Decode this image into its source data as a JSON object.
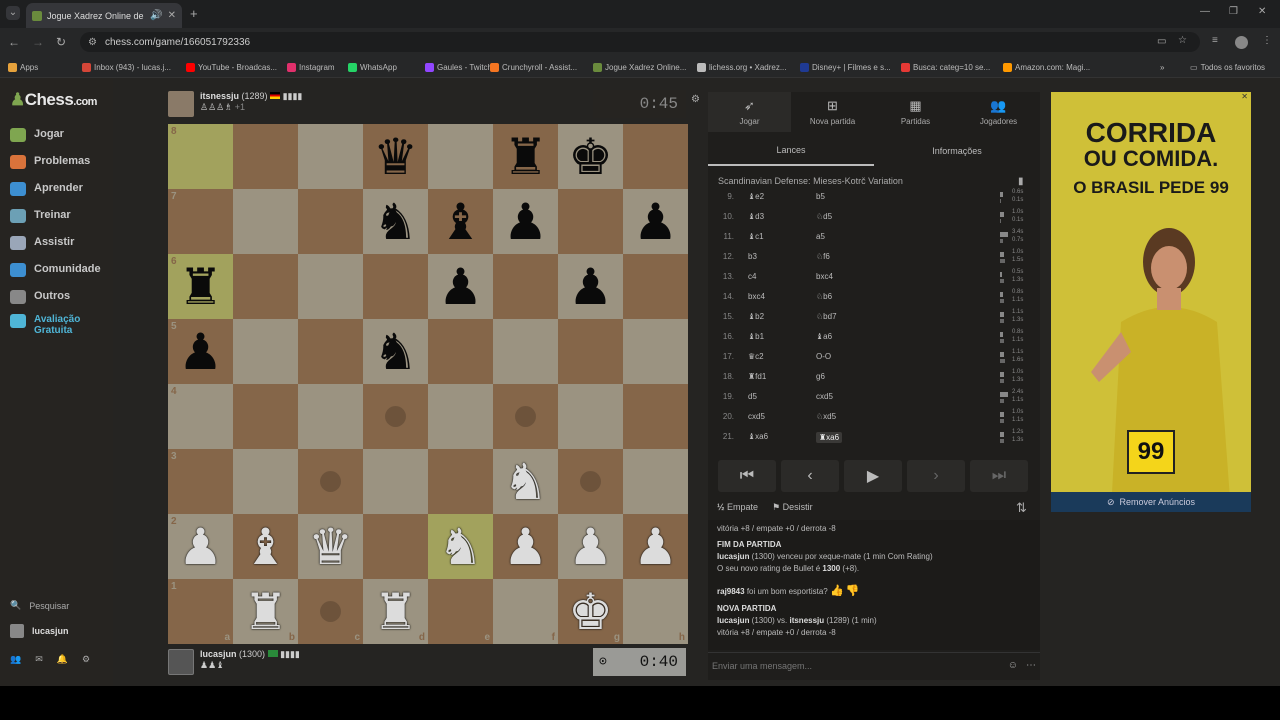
{
  "browser": {
    "tab_title": "Jogue Xadrez Online de GR",
    "url": "chess.com/game/166051792336",
    "bookmarks": [
      {
        "label": "Apps",
        "color": "#e6a23c"
      },
      {
        "label": "Inbox (943) - lucas.j...",
        "color": "#d44638"
      },
      {
        "label": "YouTube - Broadcas...",
        "color": "#ff0000"
      },
      {
        "label": "Instagram",
        "color": "#e1306c"
      },
      {
        "label": "WhatsApp",
        "color": "#25d366"
      },
      {
        "label": "Gaules - Twitch",
        "color": "#9146ff"
      },
      {
        "label": "Crunchyroll - Assist...",
        "color": "#f47521"
      },
      {
        "label": "Jogue Xadrez Online...",
        "color": "#6a8b3d"
      },
      {
        "label": "lichess.org • Xadrez...",
        "color": "#bbbbbb"
      },
      {
        "label": "Disney+ | Filmes e s...",
        "color": "#1f3a93"
      },
      {
        "label": "Busca: categ=10 se...",
        "color": "#e53935"
      },
      {
        "label": "Amazon.com: Magi...",
        "color": "#ff9900"
      }
    ],
    "all_bookmarks": "Todos os favoritos"
  },
  "sidebar": {
    "logo_main": "Chess",
    "logo_suffix": ".com",
    "items": [
      {
        "label": "Jogar",
        "color": "#7fa650"
      },
      {
        "label": "Problemas",
        "color": "#d9733b"
      },
      {
        "label": "Aprender",
        "color": "#3d8fd1"
      },
      {
        "label": "Treinar",
        "color": "#6ca0b5"
      },
      {
        "label": "Assistir",
        "color": "#9aa6b8"
      },
      {
        "label": "Comunidade",
        "color": "#3d8fd1"
      },
      {
        "label": "Outros",
        "color": "#888888"
      },
      {
        "label": "Avaliação Gratuita",
        "color": "#4fb5d6"
      }
    ],
    "search": "Pesquisar",
    "user": "lucasjun"
  },
  "game": {
    "top_player": {
      "name": "itsnessju",
      "rating": "(1289)",
      "captured": "♙♙♙♗",
      "diff": "+1",
      "clock": "0:45"
    },
    "bottom_player": {
      "name": "lucasjun",
      "rating": "(1300)",
      "captured": "♟♟♝",
      "clock": "0:40"
    },
    "ranks": [
      "8",
      "7",
      "6",
      "5",
      "4",
      "3",
      "2",
      "1"
    ],
    "files": [
      "a",
      "b",
      "c",
      "d",
      "e",
      "f",
      "g",
      "h"
    ],
    "board": [
      [
        "",
        "",
        "",
        "q",
        "",
        "r",
        "k",
        ""
      ],
      [
        "",
        "",
        "",
        "n",
        "b",
        "p",
        "",
        "p"
      ],
      [
        "r",
        "",
        "",
        "",
        "p",
        "",
        "p",
        ""
      ],
      [
        "p",
        "",
        "",
        "n",
        "",
        "",
        "",
        ""
      ],
      [
        "",
        "",
        "",
        "",
        "",
        "",
        "",
        ""
      ],
      [
        "",
        "",
        "",
        "",
        "",
        "N",
        "",
        ""
      ],
      [
        "P",
        "B",
        "Q",
        "",
        "N",
        "P",
        "P",
        "P"
      ],
      [
        "",
        "R",
        "",
        "R",
        "",
        "",
        "K",
        ""
      ]
    ],
    "highlights": [
      "a8",
      "a6",
      "e2"
    ],
    "move_dots": [
      "d4",
      "f4",
      "c3",
      "g3",
      "c1"
    ]
  },
  "panel": {
    "tabs": [
      {
        "label": "Jogar",
        "icon": "➶"
      },
      {
        "label": "Nova partida",
        "icon": "⊞"
      },
      {
        "label": "Partidas",
        "icon": "▦"
      },
      {
        "label": "Jogadores",
        "icon": "👥"
      }
    ],
    "subtabs": [
      "Lances",
      "Informações"
    ],
    "opening": "Scandinavian Defense: Mieses-Kotrč Variation",
    "moves": [
      {
        "n": "9.",
        "w": "♝e2",
        "b": "b5",
        "tw": "0.6s",
        "tb": "0.1s",
        "ww": 3,
        "wb": 1
      },
      {
        "n": "10.",
        "w": "♝d3",
        "b": "♘d5",
        "tw": "1.0s",
        "tb": "0.1s",
        "ww": 4,
        "wb": 1
      },
      {
        "n": "11.",
        "w": "♝c1",
        "b": "a5",
        "tw": "3.4s",
        "tb": "0.7s",
        "ww": 8,
        "wb": 3
      },
      {
        "n": "12.",
        "w": "b3",
        "b": "♘f6",
        "tw": "1.0s",
        "tb": "1.5s",
        "ww": 4,
        "wb": 5
      },
      {
        "n": "13.",
        "w": "c4",
        "b": "bxc4",
        "tw": "0.5s",
        "tb": "1.3s",
        "ww": 2,
        "wb": 4
      },
      {
        "n": "14.",
        "w": "bxc4",
        "b": "♘b6",
        "tw": "0.8s",
        "tb": "1.1s",
        "ww": 3,
        "wb": 4
      },
      {
        "n": "15.",
        "w": "♝b2",
        "b": "♘bd7",
        "tw": "1.1s",
        "tb": "1.3s",
        "ww": 4,
        "wb": 4
      },
      {
        "n": "16.",
        "w": "♝b1",
        "b": "♝a6",
        "tw": "0.8s",
        "tb": "1.1s",
        "ww": 3,
        "wb": 4
      },
      {
        "n": "17.",
        "w": "♛c2",
        "b": "O-O",
        "tw": "1.1s",
        "tb": "1.6s",
        "ww": 4,
        "wb": 5
      },
      {
        "n": "18.",
        "w": "♜fd1",
        "b": "g6",
        "tw": "1.0s",
        "tb": "1.3s",
        "ww": 4,
        "wb": 4
      },
      {
        "n": "19.",
        "w": "d5",
        "b": "cxd5",
        "tw": "2.4s",
        "tb": "1.1s",
        "ww": 8,
        "wb": 4
      },
      {
        "n": "20.",
        "w": "cxd5",
        "b": "♘xd5",
        "tw": "1.0s",
        "tb": "1.1s",
        "ww": 4,
        "wb": 4
      },
      {
        "n": "21.",
        "w": "♝xa6",
        "b": "♜xa6",
        "tw": "1.2s",
        "tb": "1.3s",
        "ww": 4,
        "wb": 4
      }
    ],
    "draw": "Empate",
    "resign": "Desistir",
    "chat": {
      "line1": "vitória +8 / empate +0 / derrota -8",
      "end_title": "FIM DA PARTIDA",
      "end_detail_name": "lucasjun",
      "end_detail": " (1300) venceu por xeque-mate (1 min Com Rating)",
      "rating_text": "O seu novo rating de Bullet é ",
      "rating_value": "1300",
      "rating_change": " (+8).",
      "sportsman": "raj9843",
      "sportsman_q": " foi um bom esportista?",
      "new_title": "NOVA PARTIDA",
      "new_p1": "lucasjun",
      "new_vs": " (1300) vs. ",
      "new_p2": "itsnessju",
      "new_tail": " (1289) (1 min)",
      "line_last": "vitória +8 / empate +0 / derrota -8",
      "placeholder": "Enviar uma mensagem..."
    }
  },
  "ad": {
    "title1": "CORRIDA",
    "title2": "OU COMIDA.",
    "subtitle": "O BRASIL PEDE 99",
    "badge": "99",
    "remove": "Remover Anúncios"
  }
}
